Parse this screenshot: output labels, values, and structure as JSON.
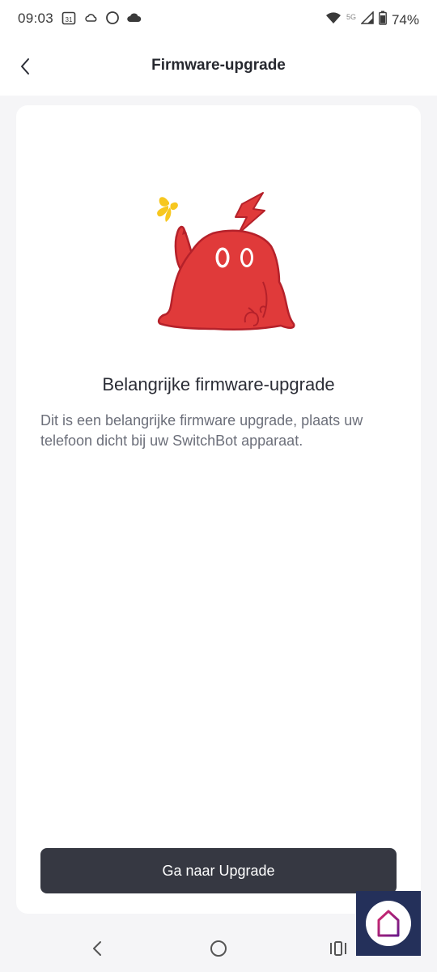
{
  "status_bar": {
    "time": "09:03",
    "calendar_day": "31",
    "network_label": "5G",
    "battery": "74%"
  },
  "header": {
    "title": "Firmware-upgrade"
  },
  "content": {
    "heading": "Belangrijke firmware-upgrade",
    "description": "Dit is een belangrijke firmware upgrade, plaats uw telefoon dicht bij uw SwitchBot apparaat."
  },
  "actions": {
    "upgrade_label": "Ga naar Upgrade"
  },
  "colors": {
    "mascot_red": "#e03a3a",
    "mascot_outline": "#b5212a",
    "butterfly_yellow": "#f7c71f",
    "button_bg": "#363842"
  },
  "icons": {
    "back": "chevron-left-icon",
    "nav_back": "nav-back-icon",
    "nav_home": "nav-home-icon",
    "nav_recents": "nav-recents-icon",
    "app": "house-app-icon"
  }
}
